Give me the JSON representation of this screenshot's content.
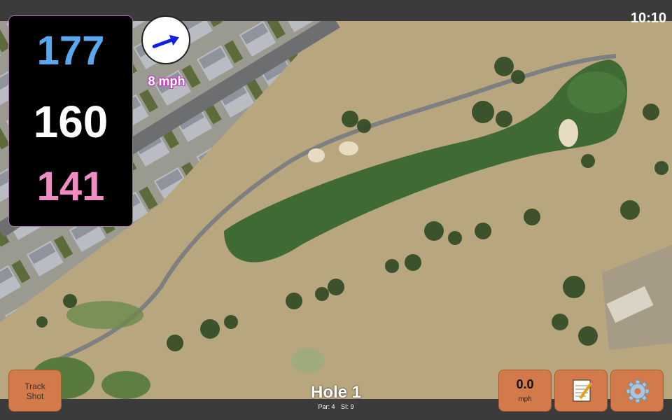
{
  "status": {
    "time": "10:10"
  },
  "distances": {
    "back": "177",
    "center": "160",
    "front": "141"
  },
  "wind": {
    "label": "8 mph",
    "icon": "wind-arrow-icon"
  },
  "buttons": {
    "track_shot": "Track\nShot",
    "speed_value": "0.0",
    "speed_unit": "mph",
    "notes_icon": "notepad-icon",
    "settings_icon": "gear-icon"
  },
  "hole": {
    "title": "Hole 1",
    "par": "Par: 4",
    "si": "SI: 9"
  },
  "colors": {
    "back_distance": "#5aa7ef",
    "center_distance": "#ffffff",
    "front_distance": "#ef8cc4",
    "button": "#d27a4a",
    "wind_label_outline": "#c23ec6"
  }
}
